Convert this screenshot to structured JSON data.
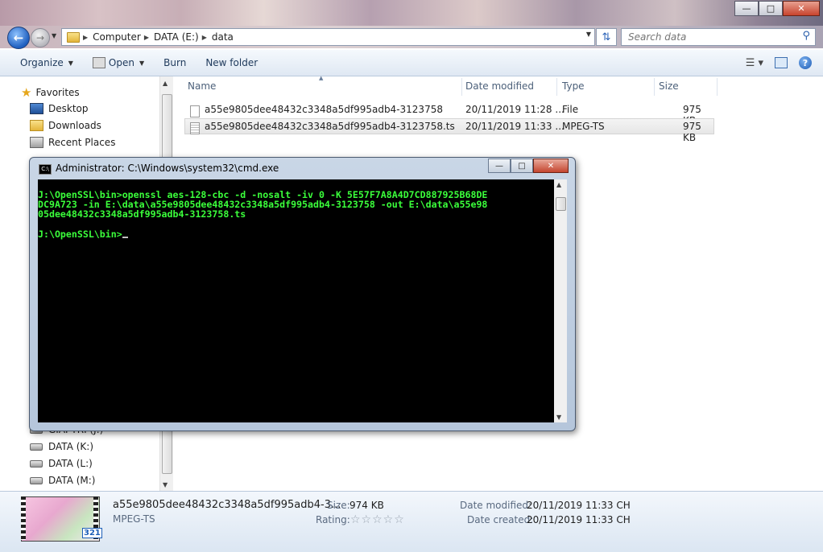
{
  "explorer": {
    "window_buttons": [
      "—",
      "□",
      "✕"
    ],
    "address": {
      "crumbs": [
        "Computer",
        "DATA (E:)",
        "data"
      ]
    },
    "search": {
      "placeholder": "Search data"
    },
    "toolbar": {
      "organize": "Organize",
      "open": "Open",
      "burn": "Burn",
      "new_folder": "New folder"
    },
    "nav": {
      "favorites": "Favorites",
      "desktop": "Desktop",
      "downloads": "Downloads",
      "recent": "Recent Places",
      "drive_partial": "GIAI TRI (J:)",
      "drives": [
        "DATA (K:)",
        "DATA (L:)",
        "DATA (M:)"
      ]
    },
    "columns": {
      "name": "Name",
      "date": "Date modified",
      "type": "Type",
      "size": "Size"
    },
    "files": [
      {
        "name": "a55e9805dee48432c3348a5df995adb4-3123758",
        "date": "20/11/2019 11:28 ...",
        "type": "File",
        "size": "975 KB"
      },
      {
        "name": "a55e9805dee48432c3348a5df995adb4-3123758.ts",
        "date": "20/11/2019 11:33 ...",
        "type": "MPEG-TS",
        "size": "975 KB"
      }
    ],
    "details": {
      "name": "a55e9805dee48432c3348a5df995adb4-3...",
      "type": "MPEG-TS",
      "size_label": "Size:",
      "size_value": "974 KB",
      "rating_label": "Rating:",
      "rating_stars": "☆☆☆☆☆",
      "modified_label": "Date modified:",
      "modified_value": "20/11/2019 11:33 CH",
      "created_label": "Date created:",
      "created_value": "20/11/2019 11:33 CH",
      "badge": "321"
    }
  },
  "cmd": {
    "title": "Administrator: C:\\Windows\\system32\\cmd.exe",
    "lines": [
      "J:\\OpenSSL\\bin>openssl aes-128-cbc -d -nosalt -iv 0 -K 5E57F7A8A4D7CD887925B68DE",
      "DC9A723 -in E:\\data\\a55e9805dee48432c3348a5df995adb4-3123758 -out E:\\data\\a55e98",
      "05dee48432c3348a5df995adb4-3123758.ts",
      "",
      "J:\\OpenSSL\\bin>"
    ]
  }
}
